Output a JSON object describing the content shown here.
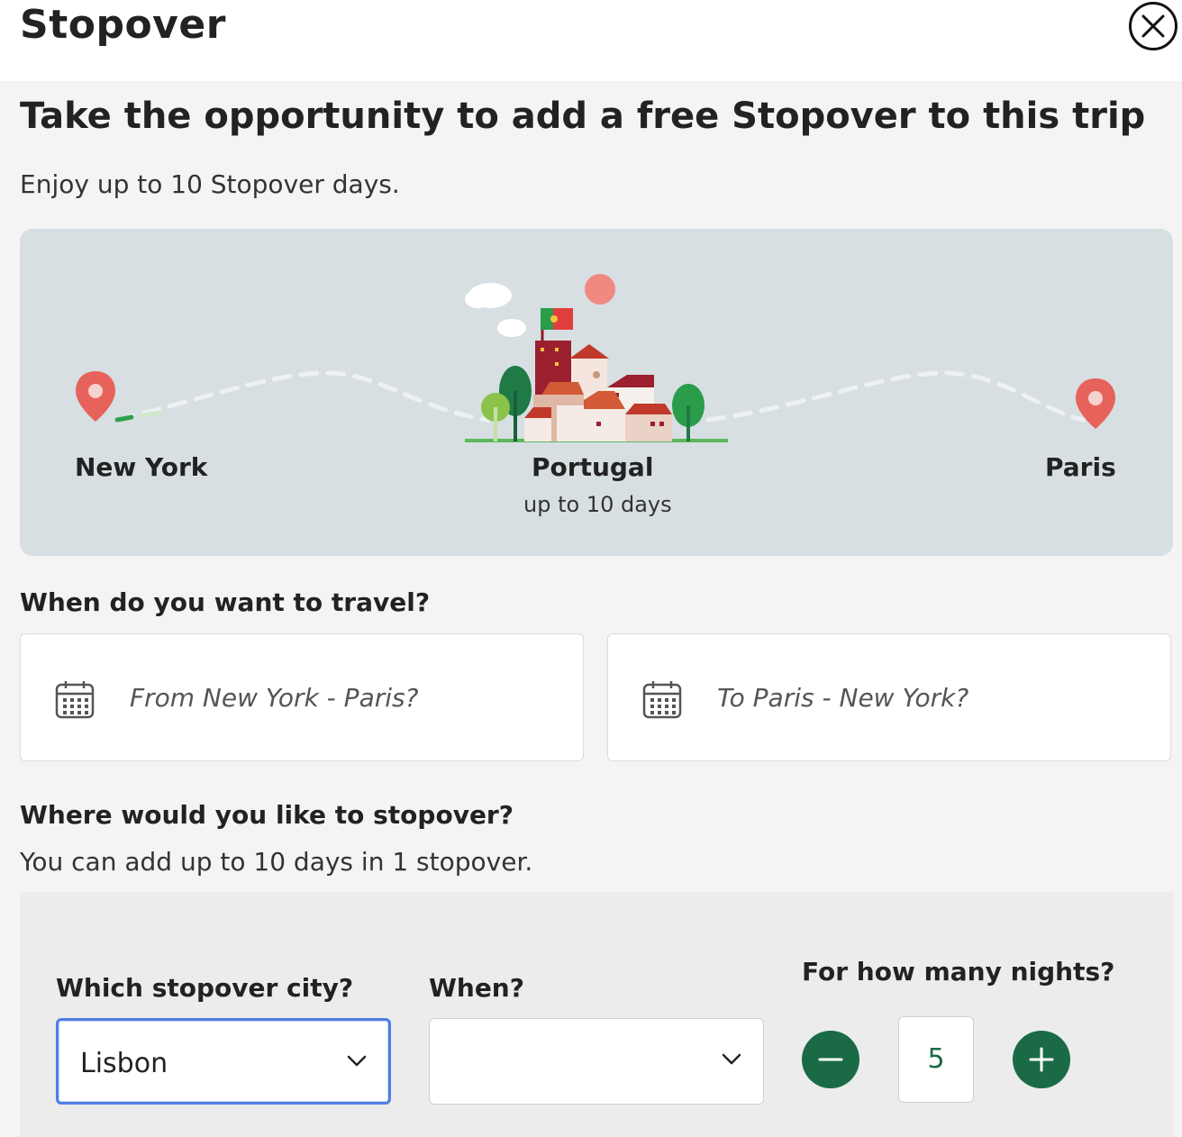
{
  "modal": {
    "title": "Stopover",
    "close_label": "Close"
  },
  "headline": "Take the opportunity to add a free Stopover to this trip",
  "subline": "Enjoy up to 10 Stopover days.",
  "route": {
    "origin": "New York",
    "stopover_country": "Portugal",
    "stopover_duration": "up to 10 days",
    "destination": "Paris"
  },
  "travel": {
    "title": "When do you want to travel?",
    "from_placeholder": "From New York - Paris?",
    "to_placeholder": "To Paris - New York?"
  },
  "stopover": {
    "title": "Where would you like to stopover?",
    "subtitle": "You can add up to 10 days in 1 stopover.",
    "city_label": "Which stopover city?",
    "city_value": "Lisbon",
    "when_label": "When?",
    "when_value": "",
    "nights_label": "For how many nights?",
    "nights_value": "5"
  },
  "colors": {
    "accent_green": "#1a6b45",
    "focus_blue": "#4f7fe6",
    "pin_red": "#e8625c",
    "route_card_bg": "#d7dfe2"
  },
  "icons": [
    "close-icon",
    "location-pin-icon",
    "calendar-icon",
    "chevron-down-icon",
    "minus-icon",
    "plus-icon"
  ]
}
